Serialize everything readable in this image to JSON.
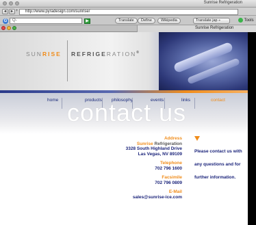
{
  "window": {
    "title": "Sunrise Refrigeration"
  },
  "nav": {
    "back": "◄",
    "forward": "►",
    "plus": "+",
    "url": "http://www.pyradesign.com/sunrise/"
  },
  "toolbar": {
    "google_letter": "G",
    "search_placeholder": "Q-",
    "go": "▶",
    "translate": "Translate",
    "define": "Define",
    "wikipedia": "Wikipedia",
    "translate_select": "Translate jap ÷",
    "tools": "Tools"
  },
  "tab": {
    "title": "Sunrise Refrigeration"
  },
  "brand": {
    "sunrise_pre": "SUN",
    "sunrise_bold": "RISE",
    "refrig_bold": "REFRIGE",
    "refrig_rest": "RATION",
    "mark": "®"
  },
  "menu": [
    {
      "label": "home",
      "active": false
    },
    {
      "label": "products",
      "active": false
    },
    {
      "label": "philosophy",
      "active": false
    },
    {
      "label": "events",
      "active": false
    },
    {
      "label": "links",
      "active": false
    },
    {
      "label": "contact",
      "active": true
    }
  ],
  "heading": "contact us",
  "address": {
    "label": "Address",
    "company_orange": "Sunrise",
    "company_rest": "Refrigeration",
    "street": "3328 South Highland Drive",
    "city": "Las Vegas, NV 89109"
  },
  "telephone": {
    "label": "Telephone",
    "value": "702 796 1600"
  },
  "facsimile": {
    "label": "Facsimile",
    "value": "702 796 0809"
  },
  "email": {
    "label": "E-Mail",
    "value": "sales@sunrise-ice.com"
  },
  "message": {
    "line1": "Please contact us with",
    "line2": "any questions and for",
    "line3": "further information."
  },
  "colors": {
    "accent": "#f08c1a",
    "navy": "#1a237a"
  }
}
